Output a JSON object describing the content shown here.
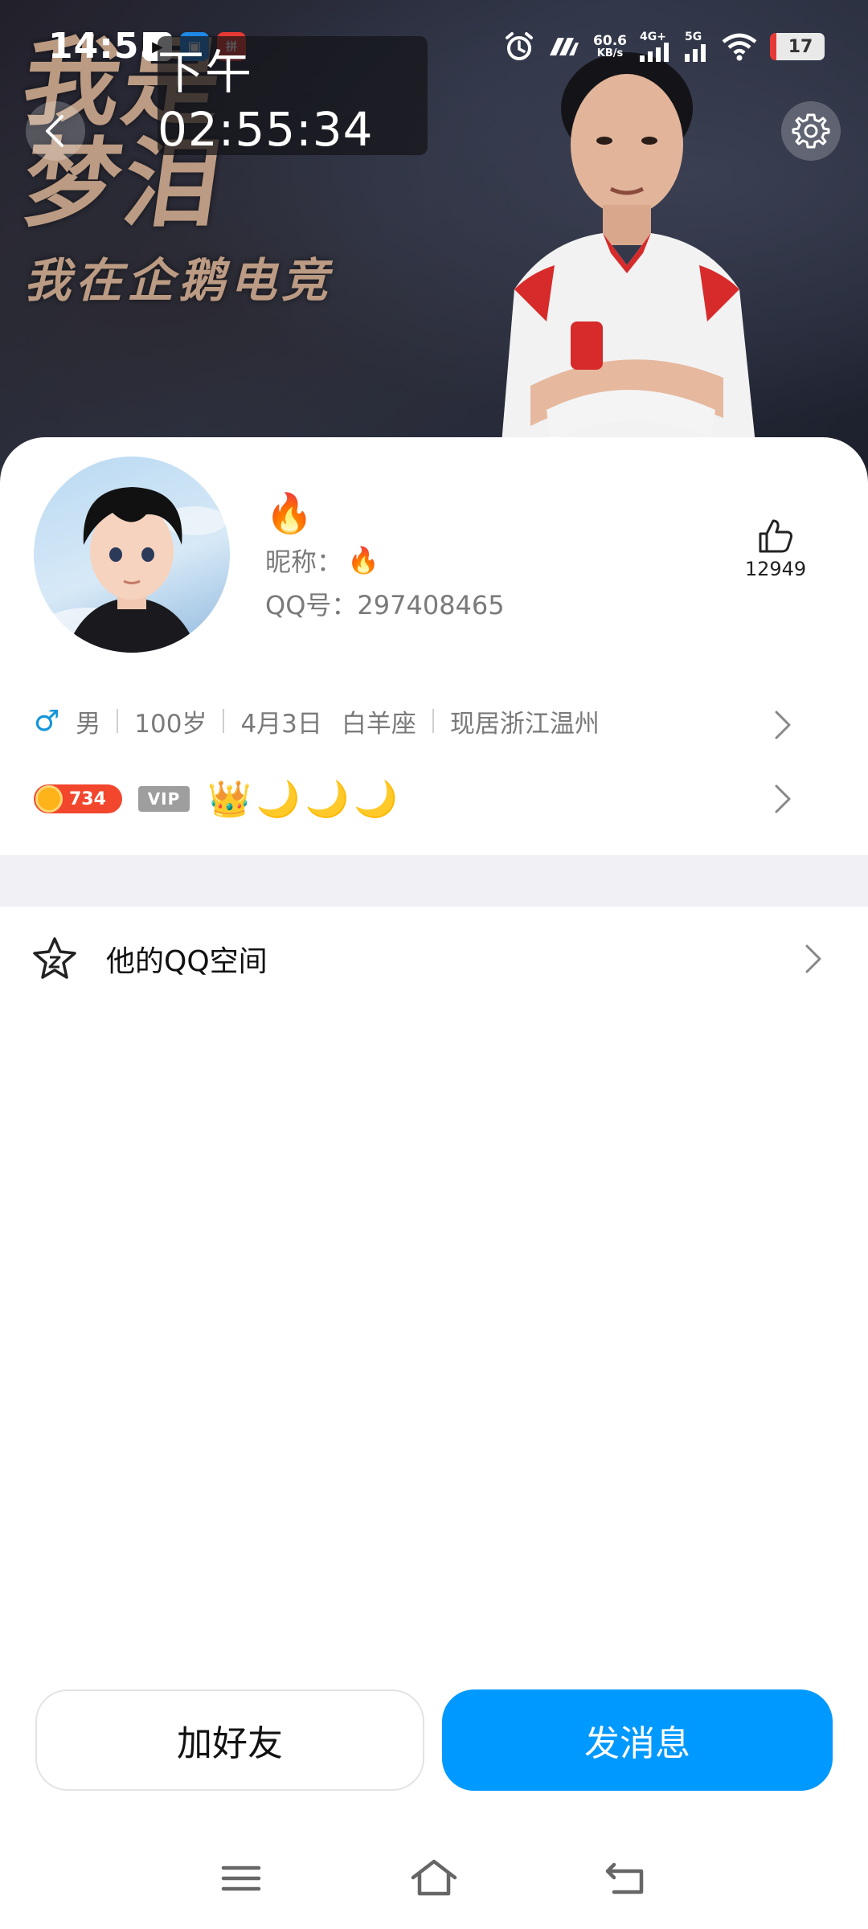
{
  "status_bar": {
    "time": "14:55",
    "apps": [
      "▶",
      "▣",
      "拼"
    ],
    "net_speed_value": "60.6",
    "net_speed_unit": "KB/s",
    "net_4g": "4G+",
    "net_5g": "5G",
    "battery": "17"
  },
  "clock_overlay": "下午02:55:34",
  "cover": {
    "brush_line1": "我是",
    "brush_line2": "梦泪",
    "brush_line3": "我在企鹅电竞"
  },
  "profile": {
    "nickname_emoji": "🔥",
    "nickname_label": "昵称：",
    "nickname_value": "🔥",
    "qq_label": "QQ号：",
    "qq_number": "297408465",
    "likes": "12949"
  },
  "info": {
    "gender_symbol": "♂",
    "gender": "男",
    "age": "100岁",
    "birthday": "4月3日",
    "zodiac": "白羊座",
    "location": "现居浙江温州"
  },
  "badges": {
    "coin_value": "734",
    "vip_label": "VIP",
    "crown": "👑",
    "moon": "🌙"
  },
  "qzone": {
    "label": "他的QQ空间"
  },
  "actions": {
    "add_friend": "加好友",
    "send_message": "发消息"
  },
  "colors": {
    "primary_blue": "#0099ff",
    "gender_blue": "#1296db",
    "coin_red": "#f2462d",
    "divider_gray": "#f0f0f5"
  }
}
